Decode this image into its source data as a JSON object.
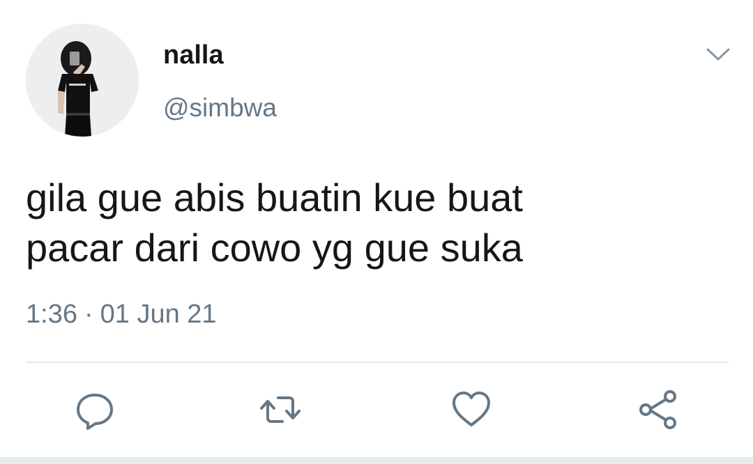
{
  "author": {
    "display_name": "nalla",
    "handle": "@simbwa"
  },
  "tweet": {
    "text": "gila gue abis buatin kue buat\npacar dari cowo yg gue suka",
    "time": "1:36",
    "separator": "·",
    "date": "01 Jun 21"
  },
  "icons": {
    "menu": "chevron-down-icon",
    "reply": "reply-icon",
    "retweet": "retweet-icon",
    "like": "heart-icon",
    "share": "share-icon"
  },
  "colors": {
    "text": "#14171a",
    "secondary": "#657786",
    "divider": "#e1e8ed"
  }
}
